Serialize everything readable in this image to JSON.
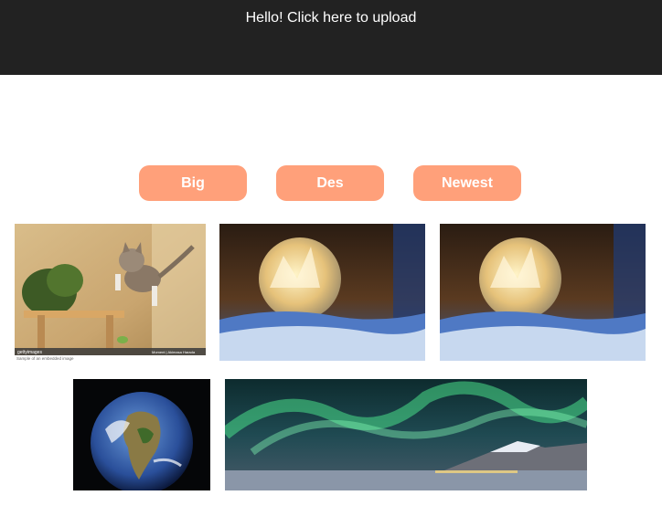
{
  "header": {
    "upload_text": "Hello! Click here to upload"
  },
  "sort_buttons": {
    "big": "Big",
    "des": "Des",
    "newest": "Newest"
  },
  "gallery": {
    "images": [
      {
        "subject": "jumping kitten",
        "watermark": "gettyimages",
        "credit": "Moment | Akimasa Harada",
        "caption": "Sample of an embedded image"
      },
      {
        "subject": "frozen soap bubble on snow"
      },
      {
        "subject": "frozen soap bubble on snow"
      },
      {
        "subject": "earth from space"
      },
      {
        "subject": "aurora borealis over mountains"
      }
    ]
  },
  "colors": {
    "header_bg": "#222222",
    "button_bg": "#ffa07a",
    "page_bg": "#ffffff"
  }
}
